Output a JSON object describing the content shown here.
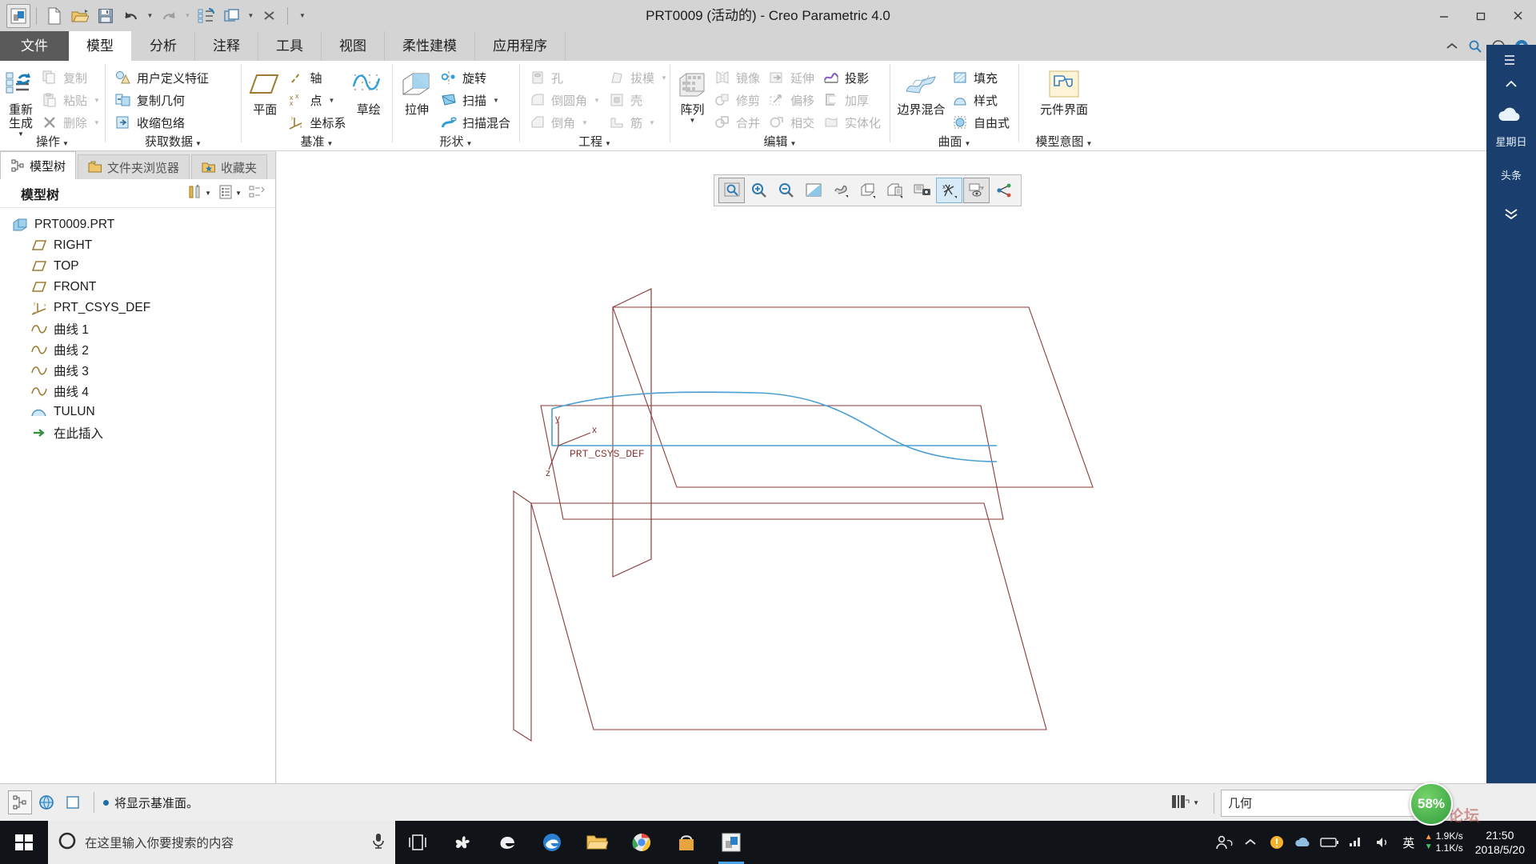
{
  "window": {
    "title": "PRT0009 (活动的) - Creo Parametric 4.0",
    "minimize": "最小化",
    "restore": "还原",
    "close": "关闭"
  },
  "quick_access": {
    "items": [
      {
        "name": "creo-logo-icon",
        "label": "Creo"
      },
      {
        "name": "new-icon",
        "label": "新建"
      },
      {
        "name": "open-icon",
        "label": "打开"
      },
      {
        "name": "save-icon",
        "label": "保存"
      },
      {
        "name": "undo-icon",
        "label": "撤消"
      },
      {
        "name": "redo-icon",
        "label": "重做"
      },
      {
        "name": "regenerate-icon",
        "label": "重新生成"
      },
      {
        "name": "window-icon",
        "label": "窗口"
      },
      {
        "name": "close-window-icon",
        "label": "关闭"
      },
      {
        "name": "customize-qat-icon",
        "label": "自定义快速访问工具栏"
      }
    ]
  },
  "tabs": [
    {
      "label": "文件",
      "kind": "file"
    },
    {
      "label": "模型",
      "kind": "active"
    },
    {
      "label": "分析",
      "kind": "normal"
    },
    {
      "label": "注释",
      "kind": "normal"
    },
    {
      "label": "工具",
      "kind": "normal"
    },
    {
      "label": "视图",
      "kind": "normal"
    },
    {
      "label": "柔性建模",
      "kind": "normal"
    },
    {
      "label": "应用程序",
      "kind": "normal"
    }
  ],
  "tab_right_icons": [
    {
      "name": "collapse-ribbon-icon"
    },
    {
      "name": "search-icon"
    },
    {
      "name": "minimize-ribbon-icon"
    },
    {
      "name": "help-icon"
    }
  ],
  "ribbon": {
    "groups": [
      {
        "label": "操作",
        "has_caret": true,
        "big": [
          {
            "label": "重新生成",
            "icon": "regenerate-icon",
            "caret": true,
            "disabled": false
          }
        ],
        "columns": [
          [
            {
              "label": "复制",
              "icon": "copy-icon",
              "disabled": true,
              "caret": false
            },
            {
              "label": "粘贴",
              "icon": "paste-icon",
              "disabled": true,
              "caret": true
            },
            {
              "label": "删除",
              "icon": "delete-icon",
              "disabled": true,
              "caret": true
            }
          ]
        ]
      },
      {
        "label": "获取数据",
        "has_caret": true,
        "big": [],
        "columns": [
          [
            {
              "label": "用户定义特征",
              "icon": "udf-icon",
              "disabled": false,
              "caret": false
            },
            {
              "label": "复制几何",
              "icon": "copy-geometry-icon",
              "disabled": false,
              "caret": false
            },
            {
              "label": "收缩包络",
              "icon": "shrinkwrap-icon",
              "disabled": false,
              "caret": false
            }
          ]
        ]
      },
      {
        "label": "基准",
        "has_caret": true,
        "big": [
          {
            "label": "平面",
            "icon": "datum-plane-icon",
            "caret": false,
            "disabled": false
          },
          {
            "label": "草绘",
            "icon": "sketch-icon",
            "caret": false,
            "disabled": false
          }
        ],
        "columns": [
          [
            {
              "label": "轴",
              "icon": "datum-axis-icon",
              "disabled": false,
              "caret": false
            },
            {
              "label": "点",
              "icon": "datum-point-icon",
              "disabled": false,
              "caret": true
            },
            {
              "label": "坐标系",
              "icon": "coordinate-system-icon",
              "disabled": false,
              "caret": false
            }
          ]
        ]
      },
      {
        "label": "形状",
        "has_caret": true,
        "big": [
          {
            "label": "拉伸",
            "icon": "extrude-icon",
            "caret": false,
            "disabled": false
          }
        ],
        "columns": [
          [
            {
              "label": "旋转",
              "icon": "revolve-icon",
              "disabled": false,
              "caret": false
            },
            {
              "label": "扫描",
              "icon": "sweep-icon",
              "disabled": false,
              "caret": true
            },
            {
              "label": "扫描混合",
              "icon": "swept-blend-icon",
              "disabled": false,
              "caret": false
            }
          ]
        ]
      },
      {
        "label": "工程",
        "has_caret": true,
        "big": [],
        "columns": [
          [
            {
              "label": "孔",
              "icon": "hole-icon",
              "disabled": true,
              "caret": false
            },
            {
              "label": "倒圆角",
              "icon": "round-icon",
              "disabled": true,
              "caret": true
            },
            {
              "label": "倒角",
              "icon": "chamfer-icon",
              "disabled": true,
              "caret": true
            }
          ],
          [
            {
              "label": "拔模",
              "icon": "draft-icon",
              "disabled": true,
              "caret": true
            },
            {
              "label": "壳",
              "icon": "shell-icon",
              "disabled": true,
              "caret": false
            },
            {
              "label": "筋",
              "icon": "rib-icon",
              "disabled": true,
              "caret": true
            }
          ]
        ]
      },
      {
        "label": "编辑",
        "has_caret": true,
        "big": [
          {
            "label": "阵列",
            "icon": "pattern-icon",
            "caret": true,
            "disabled": false
          }
        ],
        "columns": [
          [
            {
              "label": "镜像",
              "icon": "mirror-icon",
              "disabled": true,
              "caret": false
            },
            {
              "label": "修剪",
              "icon": "trim-icon",
              "disabled": true,
              "caret": false
            },
            {
              "label": "合并",
              "icon": "merge-icon",
              "disabled": true,
              "caret": false
            }
          ],
          [
            {
              "label": "延伸",
              "icon": "extend-icon",
              "disabled": true,
              "caret": false
            },
            {
              "label": "偏移",
              "icon": "offset-icon",
              "disabled": true,
              "caret": false
            },
            {
              "label": "相交",
              "icon": "intersect-icon",
              "disabled": true,
              "caret": false
            }
          ],
          [
            {
              "label": "投影",
              "icon": "project-icon",
              "disabled": false,
              "caret": false
            },
            {
              "label": "加厚",
              "icon": "thicken-icon",
              "disabled": true,
              "caret": false
            },
            {
              "label": "实体化",
              "icon": "solidify-icon",
              "disabled": true,
              "caret": false
            }
          ]
        ]
      },
      {
        "label": "曲面",
        "has_caret": true,
        "big": [
          {
            "label": "边界混合",
            "icon": "boundary-blend-icon",
            "caret": false,
            "disabled": false
          }
        ],
        "columns": [
          [
            {
              "label": "填充",
              "icon": "fill-icon",
              "disabled": false,
              "caret": false
            },
            {
              "label": "样式",
              "icon": "style-icon",
              "disabled": false,
              "caret": false
            },
            {
              "label": "自由式",
              "icon": "freestyle-icon",
              "disabled": false,
              "caret": false
            }
          ]
        ]
      },
      {
        "label": "模型意图",
        "has_caret": true,
        "big": [
          {
            "label": "元件界面",
            "icon": "component-interface-icon",
            "caret": false,
            "disabled": false
          }
        ],
        "columns": []
      }
    ]
  },
  "navigator": {
    "tabs": [
      {
        "label": "模型树",
        "icon": "model-tree-icon",
        "active": true
      },
      {
        "label": "文件夹浏览器",
        "icon": "folder-browser-icon",
        "active": false
      },
      {
        "label": "收藏夹",
        "icon": "favorites-icon",
        "active": false
      }
    ],
    "header": {
      "title": "模型树",
      "settings_icon": "tools-icon",
      "display_icon": "display-list-icon",
      "filter_icon": "tree-filter-icon"
    },
    "tree": [
      {
        "label": "PRT0009.PRT",
        "icon": "part-icon",
        "level": 0
      },
      {
        "label": "RIGHT",
        "icon": "datum-plane-icon",
        "level": 1
      },
      {
        "label": "TOP",
        "icon": "datum-plane-icon",
        "level": 1
      },
      {
        "label": "FRONT",
        "icon": "datum-plane-icon",
        "level": 1
      },
      {
        "label": "PRT_CSYS_DEF",
        "icon": "coordinate-system-icon",
        "level": 1
      },
      {
        "label": "曲线 1",
        "icon": "curve-icon",
        "level": 1
      },
      {
        "label": "曲线 2",
        "icon": "curve-icon",
        "level": 1
      },
      {
        "label": "曲线 3",
        "icon": "curve-icon",
        "level": 1
      },
      {
        "label": "曲线 4",
        "icon": "curve-icon",
        "level": 1
      },
      {
        "label": "TULUN",
        "icon": "style-feature-icon",
        "level": 1
      },
      {
        "label": "在此插入",
        "icon": "insert-here-icon",
        "level": 1
      }
    ]
  },
  "graphics_toolbar": {
    "buttons": [
      {
        "name": "refit-icon",
        "state": "framed"
      },
      {
        "name": "zoom-in-icon",
        "state": "normal"
      },
      {
        "name": "zoom-out-icon",
        "state": "normal"
      },
      {
        "name": "repaint-icon",
        "state": "normal"
      },
      {
        "name": "display-style-icon",
        "state": "normal"
      },
      {
        "name": "saved-orientations-icon",
        "state": "normal"
      },
      {
        "name": "view-manager-icon",
        "state": "normal"
      },
      {
        "name": "scene-icon",
        "state": "normal"
      },
      {
        "name": "datum-display-icon",
        "state": "selected"
      },
      {
        "name": "annotation-display-icon",
        "state": "framed"
      },
      {
        "name": "spin-center-icon",
        "state": "normal"
      }
    ]
  },
  "model_view": {
    "csys_label": "PRT_CSYS_DEF",
    "axis_labels": {
      "x": "x",
      "y": "y",
      "z": "z"
    },
    "curve_color": "#4a9fd4",
    "datum_color": "#8a3a3a"
  },
  "status_bar": {
    "buttons": [
      {
        "name": "model-tree-toggle-icon",
        "state": "framed"
      },
      {
        "name": "browser-toggle-icon",
        "state": "normal"
      },
      {
        "name": "layer-toggle-icon",
        "state": "normal"
      }
    ],
    "message": "将显示基准面。",
    "filter_icon": "selection-filter-icon",
    "filter_value": "几何"
  },
  "right_strip": {
    "weekday": "星期日",
    "headline": "头条"
  },
  "taskbar": {
    "search_placeholder": "在这里输入你要搜索的内容",
    "search_icon": "cortana-icon",
    "mic_icon": "microphone-icon",
    "items": [
      {
        "name": "task-view-icon"
      },
      {
        "name": "cortana-fan-icon"
      },
      {
        "name": "edge-icon"
      },
      {
        "name": "edge-browser-icon"
      },
      {
        "name": "file-explorer-icon"
      },
      {
        "name": "chrome-icon"
      },
      {
        "name": "store-icon"
      },
      {
        "name": "creo-taskbar-icon"
      }
    ],
    "tray": {
      "people_icon": "people-icon",
      "chevron_icon": "show-hidden-icons-icon",
      "shield_icon": "security-icon",
      "cloud_icon": "onedrive-icon",
      "battery_icon": "battery-icon",
      "network_icon": "network-icon",
      "volume_icon": "volume-icon",
      "ime_label": "英",
      "net_up": "1.9K/s",
      "net_down": "1.1K/s",
      "time": "21:50",
      "date": "2018/5/20"
    }
  },
  "overlay": {
    "progress_badge": "58%",
    "watermark": "论坛"
  }
}
